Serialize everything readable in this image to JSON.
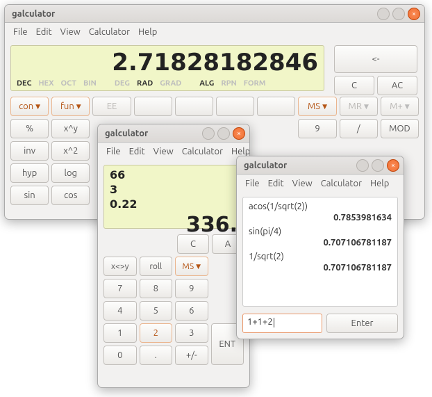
{
  "window1": {
    "title": "galculator",
    "menu": {
      "file": "File",
      "edit": "Edit",
      "view": "View",
      "calculator": "Calculator",
      "help": "Help"
    },
    "display": {
      "value": "2.71828182846"
    },
    "modes": {
      "dec": "DEC",
      "hex": "HEX",
      "oct": "OCT",
      "bin": "BIN",
      "deg": "DEG",
      "rad": "RAD",
      "grad": "GRAD",
      "alg": "ALG",
      "rpn": "RPN",
      "form": "FORM"
    },
    "buttons": {
      "back": "<-",
      "c": "C",
      "ac": "AC",
      "con": "con",
      "fun": "fun",
      "ee": "EE",
      "ms": "MS",
      "mr": "MR",
      "mplus": "M+",
      "pct": "%",
      "xpy": "x^y",
      "nine": "9",
      "slash": "/",
      "mod": "MOD",
      "inv": "inv",
      "xsq": "x^2",
      "hyp": "hyp",
      "log": "log",
      "sin": "sin",
      "cos": "cos"
    }
  },
  "window2": {
    "title": "galculator",
    "menu": {
      "file": "File",
      "edit": "Edit",
      "view": "View",
      "calculator": "Calculator",
      "help": "Help"
    },
    "stack": {
      "l1": "66",
      "l2": "3",
      "l3": "0.22"
    },
    "display": "336.",
    "buttons": {
      "c": "C",
      "a": "A",
      "swap": "x<>y",
      "roll": "roll",
      "ms": "MS",
      "seven": "7",
      "eight": "8",
      "nine": "9",
      "four": "4",
      "five": "5",
      "six": "6",
      "one": "1",
      "two": "2",
      "three": "3",
      "zero": "0",
      "dot": ".",
      "pm": "+/-",
      "ent": "ENT"
    }
  },
  "window3": {
    "title": "galculator",
    "menu": {
      "file": "File",
      "edit": "Edit",
      "view": "View",
      "calculator": "Calculator",
      "help": "Help"
    },
    "paper": {
      "l1": "acos(1/sqrt(2))",
      "r1": "0.7853981634",
      "l2": "sin(pi/4)",
      "r2": "0.707106781187",
      "l3": "1/sqrt(2)",
      "r3": "0.707106781187"
    },
    "entry": "1+1+2",
    "enter": "Enter"
  }
}
